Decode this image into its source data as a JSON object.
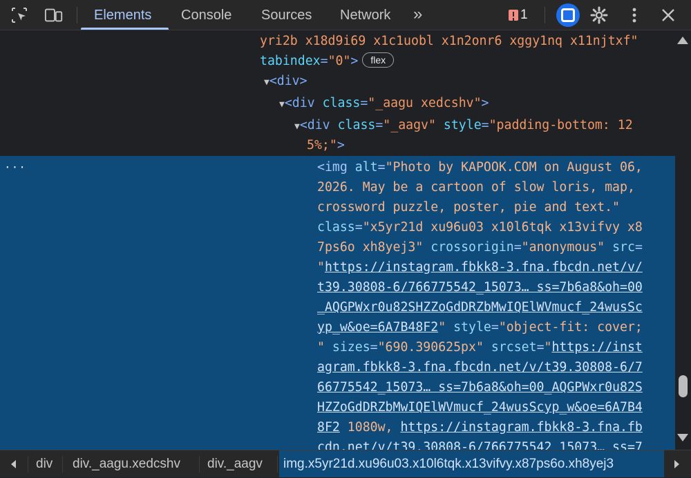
{
  "toolbar": {
    "tabs": [
      "Elements",
      "Console",
      "Sources",
      "Network"
    ],
    "active_tab": "Elements",
    "more_tabs_label": "»",
    "issues_count": "1",
    "icons": [
      "inspect-element-icon",
      "device-toolbar-icon",
      "issues-icon",
      "ai-assistance-icon",
      "settings-gear-icon",
      "more-options-icon",
      "close-icon"
    ]
  },
  "tree": {
    "lines": {
      "l1_classes": "yri2b x18d9i69 x1c1uobl x1n2onr6 xggy1nq x11njtxf\"",
      "l2_attr": "tabindex",
      "l2_val": "\"0\"",
      "flex_badge": "flex",
      "div_tag": "<div>",
      "div2_class": "\"_aagu xedcshv\"",
      "div3_class": "\"_aagv\"",
      "div3_style_a": "\"padding-bottom: 12",
      "div3_style_b": "5%;\"",
      "ellipsis": "···"
    },
    "img": {
      "alt_a": "\"Photo by KAPOOK.COM on August 06,",
      "alt_b": "2026. May be a cartoon of slow loris, map,",
      "alt_c": "crossword puzzle, poster, pie and text.\"",
      "class_a": "\"x5yr21d xu96u03 x10l6tqk x13vifvy x8",
      "class_b": "7ps6o xh8yej3\"",
      "crossorigin": "\"anonymous\"",
      "src_a": "\"",
      "src_b": "https://instagram.fbkk8-3.fna.fbcdn.net/v/",
      "src_c": "t39.30808-6/766775542_15073… ss=7b6a8&oh=00",
      "src_d": "_AQGPWxr0u82SHZZoGdDRZbMwIQElWVmucf_24wusSc",
      "src_e": "yp_w&oe=6A7B48F2",
      "style_a": "\"object-fit: cover;",
      "style_b": "\"",
      "sizes": "\"690.390625px\"",
      "srcset_a": "https://inst",
      "srcset_b": "agram.fbkk8-3.fna.fbcdn.net/v/t39.30808-6/7",
      "srcset_c": "66775542_15073… ss=7b6a8&oh=00_AQGPWxr0u82S",
      "srcset_d": "HZZoGdDRZbMwIQElWVmucf_24wusScyp_w&oe=6A7B4",
      "srcset_e": "8F2",
      "srcset_w": " 1080w, ",
      "srcset_f": "https://instagram.fbkk8-3.fna.fb",
      "srcset_g": "cdn.net/v/t39.30808-6/766775542_15073… ss=7"
    }
  },
  "breadcrumbs": [
    "div",
    "div._aagu.xedcshv",
    "div._aagv",
    "img.x5yr21d.xu96u03.x10l6tqk.x13vifvy.x87ps6o.xh8yej3"
  ],
  "colors": {
    "background": "#202124",
    "toolbar": "#282828",
    "selection": "#0e4a7a",
    "active_tab": "#a8c7fa",
    "tag": "#7cacf8",
    "attr_name": "#5cd5fb",
    "attr_value": "#f29766"
  }
}
